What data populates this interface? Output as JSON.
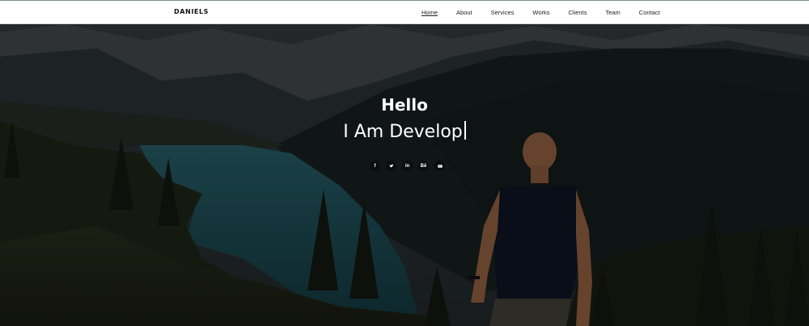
{
  "header": {
    "brand": "DANIELS",
    "nav": [
      {
        "label": "Home",
        "active": true
      },
      {
        "label": "About"
      },
      {
        "label": "Services"
      },
      {
        "label": "Works"
      },
      {
        "label": "Clients"
      },
      {
        "label": "Team"
      },
      {
        "label": "Contact"
      }
    ]
  },
  "hero": {
    "greeting": "Hello",
    "typing_text": "I Am Develop",
    "background_icon": "mountain-lake-hiker-photo",
    "overlay_color": "#000000",
    "social": [
      {
        "icon": "facebook-icon",
        "glyph": "f"
      },
      {
        "icon": "twitter-icon",
        "glyph": "t"
      },
      {
        "icon": "linkedin-icon",
        "glyph": "in"
      },
      {
        "icon": "behance-icon",
        "glyph": "Bē"
      },
      {
        "icon": "youtube-icon",
        "glyph": "▶"
      }
    ]
  }
}
